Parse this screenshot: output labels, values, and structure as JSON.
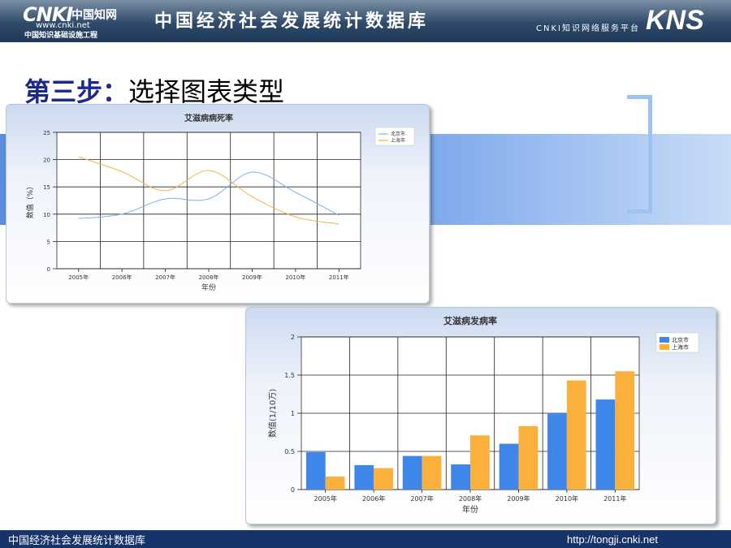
{
  "header": {
    "logo_main": "CNKI",
    "logo_cn": "中国知网",
    "logo_url": "www.cnki.net",
    "logo_sub": "中国知识基础设施工程",
    "title": "中国经济社会发展统计数据库",
    "platform": "CNKI知识网络服务平台",
    "kns": "KNS"
  },
  "slide": {
    "step_label": "第三步：",
    "step_text": "选择图表类型"
  },
  "footer": {
    "left": "中国经济社会发展统计数据库",
    "right": "http://tongji.cnki.net"
  },
  "colors": {
    "beijing": "#7fb2ea",
    "shanghai": "#f8b14a",
    "bar_beijing": "#3f86ea",
    "bar_shanghai": "#fbb03b",
    "header_bg": "#2f4a6a",
    "footer_bg": "#16346a"
  },
  "chart_data": [
    {
      "type": "line",
      "title": "艾滋病病死率",
      "xlabel": "年份",
      "ylabel": "数值（%）",
      "categories": [
        "2005年",
        "2006年",
        "2007年",
        "2008年",
        "2009年",
        "2010年",
        "2011年"
      ],
      "series": [
        {
          "name": "北京市",
          "values": [
            9.2,
            10.0,
            12.8,
            12.8,
            17.7,
            14.0,
            9.8
          ]
        },
        {
          "name": "上海市",
          "values": [
            20.5,
            17.8,
            14.3,
            18.0,
            13.2,
            9.5,
            8.2
          ]
        }
      ],
      "ylim": [
        0,
        25
      ],
      "yticks": [
        0,
        5,
        10,
        15,
        20,
        25
      ],
      "grid": true,
      "legend": "top-right"
    },
    {
      "type": "bar",
      "title": "艾滋病发病率",
      "xlabel": "年份",
      "ylabel": "数值(1/10万)",
      "categories": [
        "2005年",
        "2006年",
        "2007年",
        "2008年",
        "2009年",
        "2010年",
        "2011年"
      ],
      "series": [
        {
          "name": "北京市",
          "values": [
            0.49,
            0.32,
            0.44,
            0.33,
            0.6,
            1.0,
            1.18
          ]
        },
        {
          "name": "上海市",
          "values": [
            0.17,
            0.28,
            0.44,
            0.71,
            0.83,
            1.43,
            1.55
          ]
        }
      ],
      "ylim": [
        0,
        2
      ],
      "yticks": [
        0,
        0.5,
        1,
        1.5,
        2
      ],
      "ytick_labels": [
        "0",
        "0.5",
        "1",
        "1.5",
        "2"
      ],
      "grid": true,
      "legend": "top-right"
    }
  ]
}
